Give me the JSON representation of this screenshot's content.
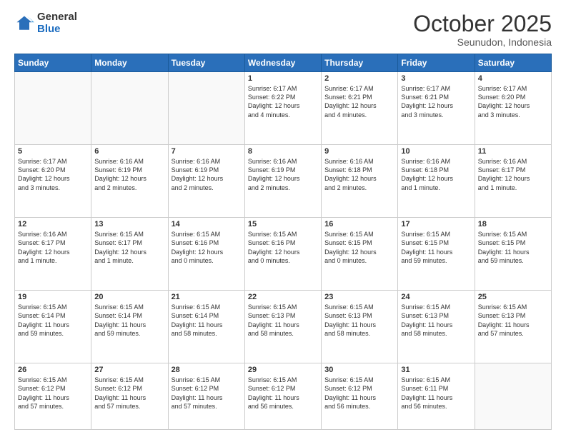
{
  "logo": {
    "general": "General",
    "blue": "Blue"
  },
  "header": {
    "month": "October 2025",
    "location": "Seunudon, Indonesia"
  },
  "weekdays": [
    "Sunday",
    "Monday",
    "Tuesday",
    "Wednesday",
    "Thursday",
    "Friday",
    "Saturday"
  ],
  "weeks": [
    [
      {
        "day": "",
        "info": ""
      },
      {
        "day": "",
        "info": ""
      },
      {
        "day": "",
        "info": ""
      },
      {
        "day": "1",
        "info": "Sunrise: 6:17 AM\nSunset: 6:22 PM\nDaylight: 12 hours\nand 4 minutes."
      },
      {
        "day": "2",
        "info": "Sunrise: 6:17 AM\nSunset: 6:21 PM\nDaylight: 12 hours\nand 4 minutes."
      },
      {
        "day": "3",
        "info": "Sunrise: 6:17 AM\nSunset: 6:21 PM\nDaylight: 12 hours\nand 3 minutes."
      },
      {
        "day": "4",
        "info": "Sunrise: 6:17 AM\nSunset: 6:20 PM\nDaylight: 12 hours\nand 3 minutes."
      }
    ],
    [
      {
        "day": "5",
        "info": "Sunrise: 6:17 AM\nSunset: 6:20 PM\nDaylight: 12 hours\nand 3 minutes."
      },
      {
        "day": "6",
        "info": "Sunrise: 6:16 AM\nSunset: 6:19 PM\nDaylight: 12 hours\nand 2 minutes."
      },
      {
        "day": "7",
        "info": "Sunrise: 6:16 AM\nSunset: 6:19 PM\nDaylight: 12 hours\nand 2 minutes."
      },
      {
        "day": "8",
        "info": "Sunrise: 6:16 AM\nSunset: 6:19 PM\nDaylight: 12 hours\nand 2 minutes."
      },
      {
        "day": "9",
        "info": "Sunrise: 6:16 AM\nSunset: 6:18 PM\nDaylight: 12 hours\nand 2 minutes."
      },
      {
        "day": "10",
        "info": "Sunrise: 6:16 AM\nSunset: 6:18 PM\nDaylight: 12 hours\nand 1 minute."
      },
      {
        "day": "11",
        "info": "Sunrise: 6:16 AM\nSunset: 6:17 PM\nDaylight: 12 hours\nand 1 minute."
      }
    ],
    [
      {
        "day": "12",
        "info": "Sunrise: 6:16 AM\nSunset: 6:17 PM\nDaylight: 12 hours\nand 1 minute."
      },
      {
        "day": "13",
        "info": "Sunrise: 6:15 AM\nSunset: 6:17 PM\nDaylight: 12 hours\nand 1 minute."
      },
      {
        "day": "14",
        "info": "Sunrise: 6:15 AM\nSunset: 6:16 PM\nDaylight: 12 hours\nand 0 minutes."
      },
      {
        "day": "15",
        "info": "Sunrise: 6:15 AM\nSunset: 6:16 PM\nDaylight: 12 hours\nand 0 minutes."
      },
      {
        "day": "16",
        "info": "Sunrise: 6:15 AM\nSunset: 6:15 PM\nDaylight: 12 hours\nand 0 minutes."
      },
      {
        "day": "17",
        "info": "Sunrise: 6:15 AM\nSunset: 6:15 PM\nDaylight: 11 hours\nand 59 minutes."
      },
      {
        "day": "18",
        "info": "Sunrise: 6:15 AM\nSunset: 6:15 PM\nDaylight: 11 hours\nand 59 minutes."
      }
    ],
    [
      {
        "day": "19",
        "info": "Sunrise: 6:15 AM\nSunset: 6:14 PM\nDaylight: 11 hours\nand 59 minutes."
      },
      {
        "day": "20",
        "info": "Sunrise: 6:15 AM\nSunset: 6:14 PM\nDaylight: 11 hours\nand 59 minutes."
      },
      {
        "day": "21",
        "info": "Sunrise: 6:15 AM\nSunset: 6:14 PM\nDaylight: 11 hours\nand 58 minutes."
      },
      {
        "day": "22",
        "info": "Sunrise: 6:15 AM\nSunset: 6:13 PM\nDaylight: 11 hours\nand 58 minutes."
      },
      {
        "day": "23",
        "info": "Sunrise: 6:15 AM\nSunset: 6:13 PM\nDaylight: 11 hours\nand 58 minutes."
      },
      {
        "day": "24",
        "info": "Sunrise: 6:15 AM\nSunset: 6:13 PM\nDaylight: 11 hours\nand 58 minutes."
      },
      {
        "day": "25",
        "info": "Sunrise: 6:15 AM\nSunset: 6:13 PM\nDaylight: 11 hours\nand 57 minutes."
      }
    ],
    [
      {
        "day": "26",
        "info": "Sunrise: 6:15 AM\nSunset: 6:12 PM\nDaylight: 11 hours\nand 57 minutes."
      },
      {
        "day": "27",
        "info": "Sunrise: 6:15 AM\nSunset: 6:12 PM\nDaylight: 11 hours\nand 57 minutes."
      },
      {
        "day": "28",
        "info": "Sunrise: 6:15 AM\nSunset: 6:12 PM\nDaylight: 11 hours\nand 57 minutes."
      },
      {
        "day": "29",
        "info": "Sunrise: 6:15 AM\nSunset: 6:12 PM\nDaylight: 11 hours\nand 56 minutes."
      },
      {
        "day": "30",
        "info": "Sunrise: 6:15 AM\nSunset: 6:12 PM\nDaylight: 11 hours\nand 56 minutes."
      },
      {
        "day": "31",
        "info": "Sunrise: 6:15 AM\nSunset: 6:11 PM\nDaylight: 11 hours\nand 56 minutes."
      },
      {
        "day": "",
        "info": ""
      }
    ]
  ]
}
